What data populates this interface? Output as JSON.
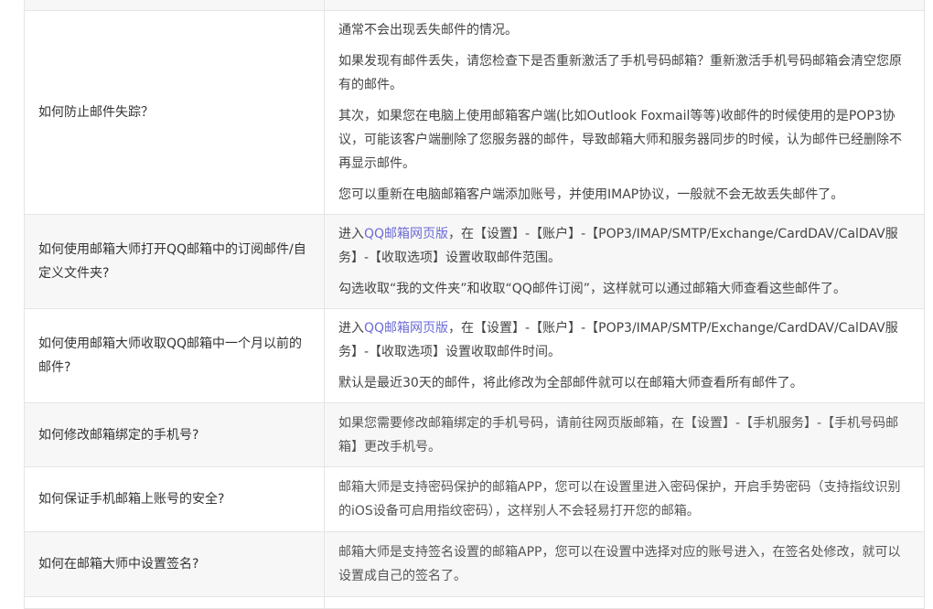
{
  "faq": [
    {
      "question": "如何防止邮件失踪？",
      "answers": [
        "通常不会出现丢失邮件的情况。",
        "如果发现有邮件丢失，请您检查下是否重新激活了手机号码邮箱？重新激活手机号码邮箱会清空您原有的邮件。",
        "其次，如果您在电脑上使用邮箱客户端(比如Outlook Foxmail等等)收邮件的时候使用的是POP3协议，可能该客户端删除了您服务器的邮件，导致邮箱大师和服务器同步的时候，认为邮件已经删除不再显示邮件。",
        "您可以重新在电脑邮箱客户端添加账号，并使用IMAP协议，一般就不会无故丢失邮件了。"
      ]
    },
    {
      "question": "如何使用邮箱大师打开QQ邮箱中的订阅邮件/自定义文件夹?",
      "answer1_prefix": "进入",
      "answer1_link": "QQ邮箱网页版",
      "answer1_suffix": "，在【设置】-【账户】-【POP3/IMAP/SMTP/Exchange/CardDAV/CalDAV服务】-【收取选项】设置收取邮件范围。",
      "answer2": "勾选收取“我的文件夹”和收取“QQ邮件订阅”，这样就可以通过邮箱大师查看这些邮件了。"
    },
    {
      "question": "如何使用邮箱大师收取QQ邮箱中一个月以前的邮件?",
      "answer1_prefix": "进入",
      "answer1_link": "QQ邮箱网页版",
      "answer1_suffix": "，在【设置】-【账户】-【POP3/IMAP/SMTP/Exchange/CardDAV/CalDAV服务】-【收取选项】设置收取邮件时间。",
      "answer2": "默认是最近30天的邮件，将此修改为全部邮件就可以在邮箱大师查看所有邮件了。"
    },
    {
      "question": "如何修改邮箱绑定的手机号?",
      "answer": "如果您需要修改邮箱绑定的手机号码，请前往网页版邮箱，在【设置】-【手机服务】-【手机号码邮箱】更改手机号。"
    },
    {
      "question": "如何保证手机邮箱上账号的安全?",
      "answer": "邮箱大师是支持密码保护的邮箱APP，您可以在设置里进入密码保护，开启手势密码（支持指纹识别的iOS设备可启用指纹密码），这样别人不会轻易打开您的邮箱。"
    },
    {
      "question": "如何在邮箱大师中设置签名?",
      "answer": "邮箱大师是支持签名设置的邮箱APP，您可以在设置中选择对应的账号进入，在签名处修改，就可以设置成自己的签名了。"
    }
  ]
}
